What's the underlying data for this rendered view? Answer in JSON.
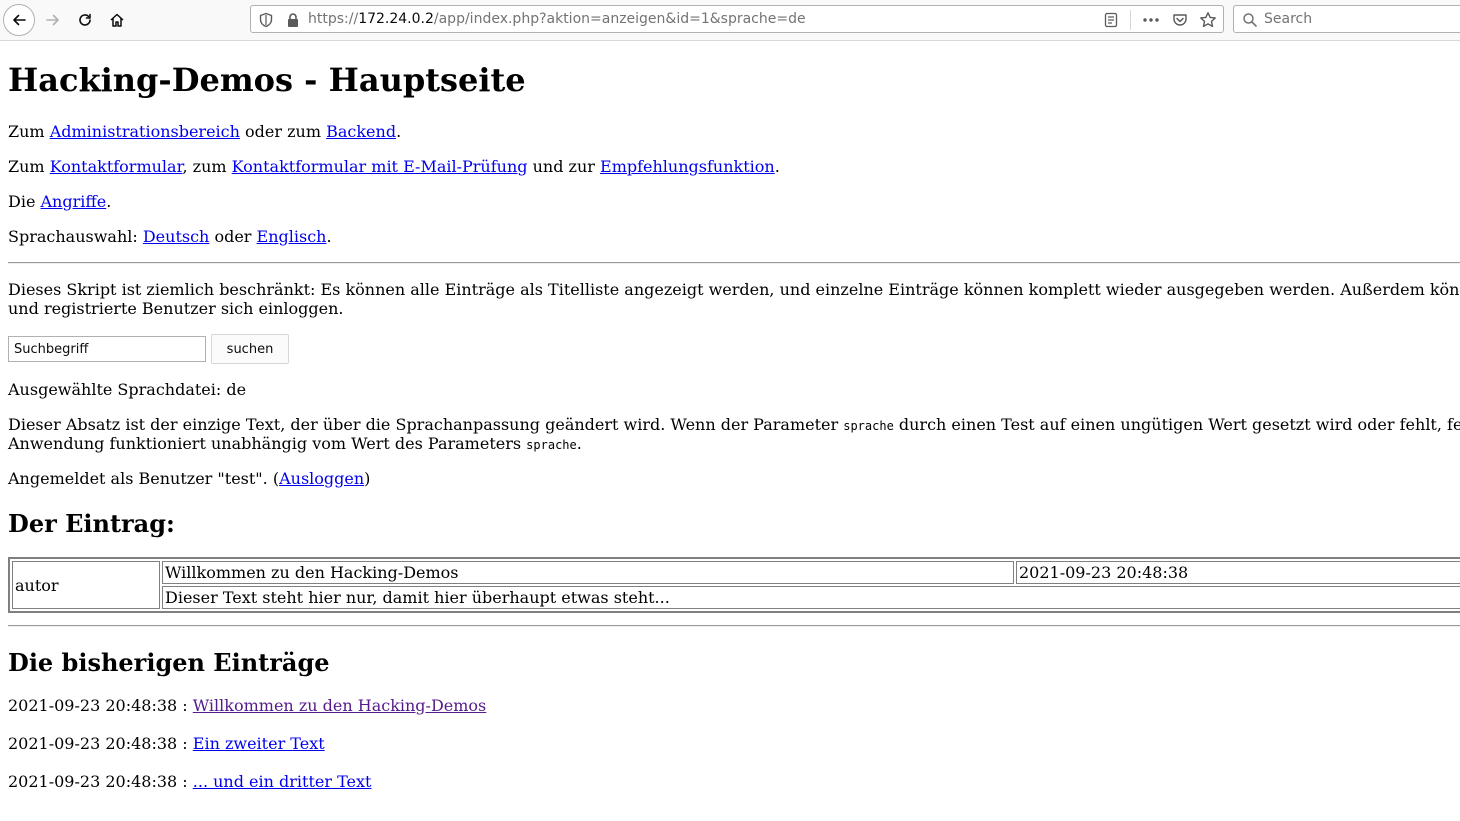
{
  "browser": {
    "url_prefix": "https://",
    "url_host": "172.24.0.2",
    "url_path": "/app/index.php?aktion=anzeigen&id=1&sprache=de",
    "search_placeholder": "Search"
  },
  "page": {
    "heading": "Hacking-Demos - Hauptseite",
    "line1": {
      "pre": "Zum ",
      "link1": "Administrationsbereich",
      "mid": " oder zum ",
      "link2": "Backend",
      "post": "."
    },
    "line2": {
      "pre": "Zum ",
      "link1": "Kontaktformular",
      "mid1": ", zum ",
      "link2": "Kontaktformular mit E-Mail-Prüfung",
      "mid2": " und zur ",
      "link3": "Empfehlungsfunktion",
      "post": "."
    },
    "line3": {
      "pre": "Die ",
      "link": "Angriffe",
      "post": "."
    },
    "line4": {
      "pre": "Sprachauswahl: ",
      "link1": "Deutsch",
      "mid": " oder ",
      "link2": "Englisch",
      "post": "."
    },
    "description_line1": "Dieses Skript ist ziemlich beschränkt: Es können alle Einträge als Titelliste angezeigt werden, und einzelne Einträge können komplett wieder ausgegeben werden. Außerdem kön",
    "description_line2": "und registrierte Benutzer sich einloggen.",
    "search": {
      "value": "Suchbegriff",
      "button": "suchen"
    },
    "language_file": "Ausgewählte Sprachdatei: de",
    "lang_para": {
      "l1_pre": "Dieser Absatz ist der einzige Text, der über die Sprachanpassung geändert wird. Wenn der Parameter ",
      "code1": "sprache",
      "l1_post": " durch einen Test auf einen ungütigen Wert gesetzt wird oder fehlt, fe",
      "l2_pre": "Anwendung funktioniert unabhängig vom Wert des Parameters ",
      "code2": "sprache",
      "l2_post": "."
    },
    "login": {
      "pre": "Angemeldet als Benutzer \"test\". (",
      "link": "Ausloggen",
      "post": ")"
    },
    "entry_heading": "Der Eintrag:",
    "entry": {
      "author": "autor",
      "title": "Willkommen zu den Hacking-Demos",
      "date": "2021-09-23 20:48:38",
      "text": "Dieser Text steht hier nur, damit hier überhaupt etwas steht..."
    },
    "list_heading": "Die bisherigen Einträge",
    "entries": [
      {
        "date": "2021-09-23 20:48:38",
        "sep": " : ",
        "title": "Willkommen zu den Hacking-Demos",
        "visited": true
      },
      {
        "date": "2021-09-23 20:48:38",
        "sep": " : ",
        "title": "Ein zweiter Text",
        "visited": false
      },
      {
        "date": "2021-09-23 20:48:38",
        "sep": " : ",
        "title": "... und ein dritter Text",
        "visited": false
      }
    ]
  }
}
